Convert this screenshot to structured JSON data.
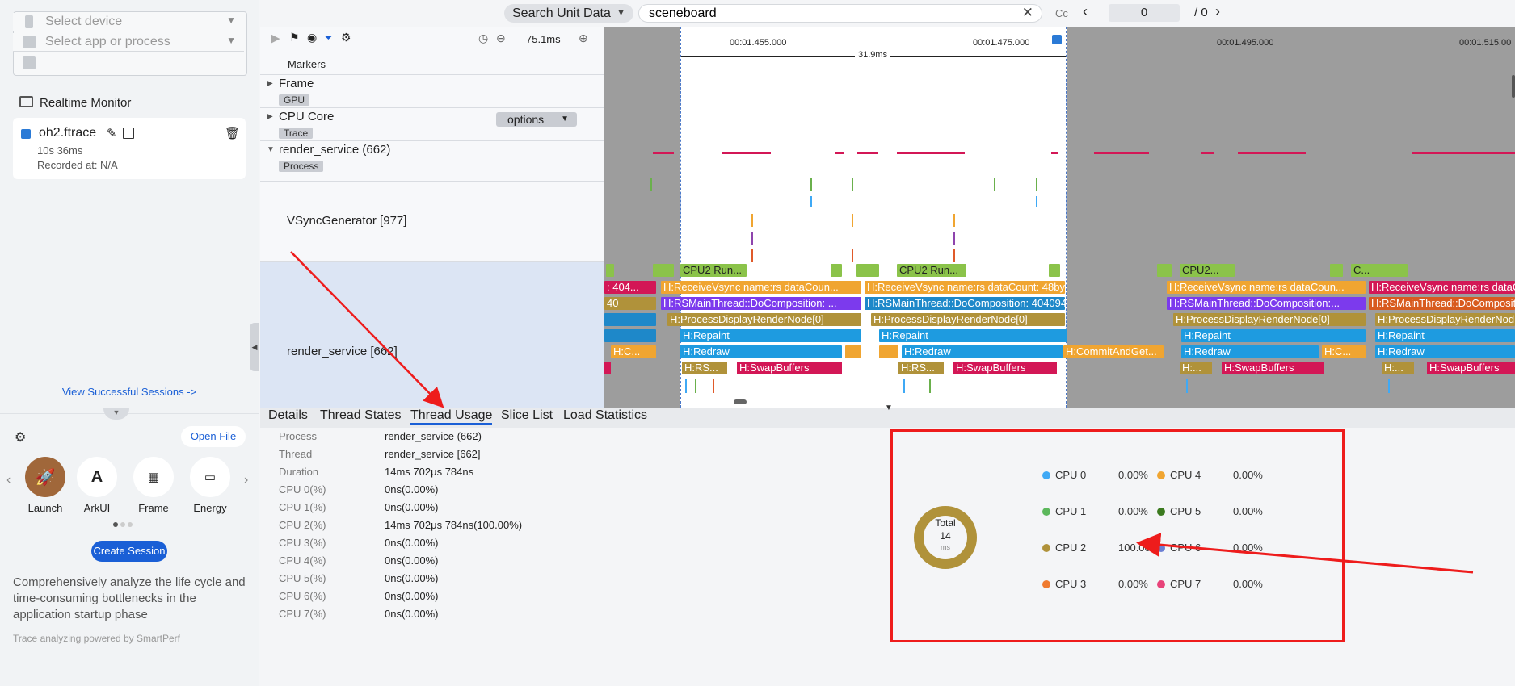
{
  "sidebar": {
    "select_device": "Select device",
    "select_app": "Select app or process",
    "realtime_monitor": "Realtime Monitor",
    "session": {
      "name": "oh2.ftrace",
      "duration": "10s 36ms",
      "recorded": "Recorded at: N/A"
    },
    "view_sessions": "View Successful Sessions ->",
    "open_file": "Open File",
    "launch_items": [
      {
        "label": "Launch",
        "icon": "rocket-icon"
      },
      {
        "label": "ArkUI",
        "icon": "arkui-icon"
      },
      {
        "label": "Frame",
        "icon": "frame-icon"
      },
      {
        "label": "Energy",
        "icon": "battery-icon"
      }
    ],
    "create_session": "Create Session",
    "description": "Comprehensively analyze the life cycle and time-consuming bottlenecks in the application startup phase",
    "powered": "Trace analyzing powered by SmartPerf"
  },
  "header": {
    "search_unit": "Search Unit Data",
    "search_value": "sceneboard",
    "cc": "Cc",
    "page_current": "0",
    "page_total": "/ 0"
  },
  "toolbar": {
    "zoom": "75.1ms"
  },
  "timeline": {
    "ticks": [
      "00:01.455.000",
      "00:01.475.000",
      "00:01.495.000",
      "00:01.515.00"
    ],
    "range": "31.9ms"
  },
  "tracks": {
    "markers": "Markers",
    "frame": "Frame",
    "frame_tag": "GPU",
    "cpu_core": "CPU Core",
    "cpu_tag": "Trace",
    "options": "options",
    "render_service": "render_service (662)",
    "rs_tag": "Process",
    "vsync": "VSyncGenerator [977]",
    "rs_thread": "render_service [662]"
  },
  "slices": {
    "cpu2_a": "CPU2 Run...",
    "cpu2_b": "CPU2 Run...",
    "cpu2_c": "CPU2...",
    "c_d": "C...",
    "rv_a": ": 404...",
    "rv_b": "H:ReceiveVsync name:rs dataCoun...",
    "rv_c": "H:ReceiveVsync name:rs dataCount: 48bytes now: 4...",
    "rv_d": "H:ReceiveVsync name:rs dataCoun...",
    "rv_e": "H:ReceiveVsync name:rs dataCount...",
    "rm_a": "40",
    "rm_b": "H:RSMainThread::DoComposition: ...",
    "rm_c": "H:RSMainThread::DoComposition: 4040942577240",
    "rm_d": "H:RSMainThread::DoComposition:...",
    "rm_e": "H:RSMainThread::DoComposition",
    "pd_a": "H:ProcessDisplayRenderNode[0]",
    "pd_b": "H:ProcessDisplayRenderNode[0]",
    "pd_c": "H:ProcessDisplayRenderNode[0]",
    "pd_d": "H:ProcessDisplayRenderNod",
    "rp_a": "H:Repaint",
    "rp_b": "H:Repaint",
    "rp_c": "H:Repaint",
    "rp_d": "H:Repaint",
    "rd_a": "H:C...",
    "rd_b": "H:Redraw",
    "rd_c": "H:Redraw",
    "rd_d": "H:CommitAndGet...",
    "rd_e": "H:Redraw",
    "rd_f": "H:C...",
    "rd_g": "H:Redraw",
    "rs_a": "H:RS...",
    "sb_a": "H:SwapBuffers",
    "rs_b": "H:RS...",
    "sb_b": "H:SwapBuffers",
    "rs_c": "H:...",
    "sb_c": "H:SwapBuffers",
    "rs_d": "H:...",
    "sb_d": "H:SwapBuffers"
  },
  "tabs": [
    "Details",
    "Thread States",
    "Thread Usage",
    "Slice List",
    "Load Statistics"
  ],
  "details": [
    {
      "k": "Process",
      "v": "render_service (662)"
    },
    {
      "k": "Thread",
      "v": "render_service [662]"
    },
    {
      "k": "Duration",
      "v": "14ms 702μs 784ns"
    },
    {
      "k": "CPU 0(%)",
      "v": "0ns(0.00%)"
    },
    {
      "k": "CPU 1(%)",
      "v": "0ns(0.00%)"
    },
    {
      "k": "CPU 2(%)",
      "v": "14ms 702μs 784ns(100.00%)"
    },
    {
      "k": "CPU 3(%)",
      "v": "0ns(0.00%)"
    },
    {
      "k": "CPU 4(%)",
      "v": "0ns(0.00%)"
    },
    {
      "k": "CPU 5(%)",
      "v": "0ns(0.00%)"
    },
    {
      "k": "CPU 6(%)",
      "v": "0ns(0.00%)"
    },
    {
      "k": "CPU 7(%)",
      "v": "0ns(0.00%)"
    }
  ],
  "donut": {
    "label": "Total",
    "value": "14",
    "unit": "ms"
  },
  "cpu_legend": [
    {
      "name": "CPU 0",
      "pct": "0.00%",
      "color": "#3fa9f5"
    },
    {
      "name": "CPU 4",
      "pct": "0.00%",
      "color": "#f0a531"
    },
    {
      "name": "CPU 1",
      "pct": "0.00%",
      "color": "#5cb85c"
    },
    {
      "name": "CPU 5",
      "pct": "0.00%",
      "color": "#3b7a1f"
    },
    {
      "name": "CPU 2",
      "pct": "100.00%",
      "color": "#b0923a"
    },
    {
      "name": "CPU 6",
      "pct": "0.00%",
      "color": "#6b7fd4"
    },
    {
      "name": "CPU 3",
      "pct": "0.00%",
      "color": "#ef7a2f"
    },
    {
      "name": "CPU 7",
      "pct": "0.00%",
      "color": "#e8437a"
    }
  ],
  "colors": {
    "accent": "#1a5fd6",
    "annotation": "#ee1c1c"
  }
}
